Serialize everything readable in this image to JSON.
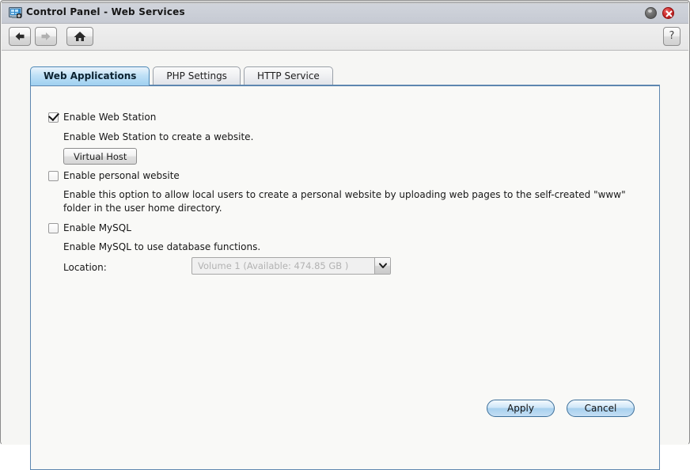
{
  "window": {
    "title": "Control Panel - Web Services",
    "icon": "control-panel-icon",
    "minimize_label": "",
    "close_label": "✕"
  },
  "toolbar": {
    "back_icon": "arrow-left-icon",
    "forward_icon": "arrow-right-icon",
    "home_icon": "home-icon",
    "help_label": "?"
  },
  "tabs": [
    {
      "label": "Web Applications",
      "active": true
    },
    {
      "label": "PHP Settings",
      "active": false
    },
    {
      "label": "HTTP Service",
      "active": false
    }
  ],
  "sections": {
    "web_station": {
      "checkbox_label": "Enable Web Station",
      "checked": true,
      "description": "Enable Web Station to create a website.",
      "button_label": "Virtual Host"
    },
    "personal_website": {
      "checkbox_label": "Enable personal website",
      "checked": false,
      "description": "Enable this option to allow local users to create a personal website by uploading web pages to the self-created \"www\" folder in the user home directory."
    },
    "mysql": {
      "checkbox_label": "Enable MySQL",
      "checked": false,
      "description": "Enable MySQL to use database functions.",
      "location_label": "Location:",
      "location_value": "Volume 1 (Available: 474.85 GB )",
      "location_icon": "chevron-down-icon",
      "location_disabled": true
    }
  },
  "footer": {
    "apply_label": "Apply",
    "cancel_label": "Cancel"
  },
  "colors": {
    "accent_blue": "#5e87b0",
    "active_tab": "#9fd0f0",
    "close_red": "#cf2b2b",
    "panel_bg": "#f9f9f7",
    "disabled_text": "#b2b2b2"
  }
}
